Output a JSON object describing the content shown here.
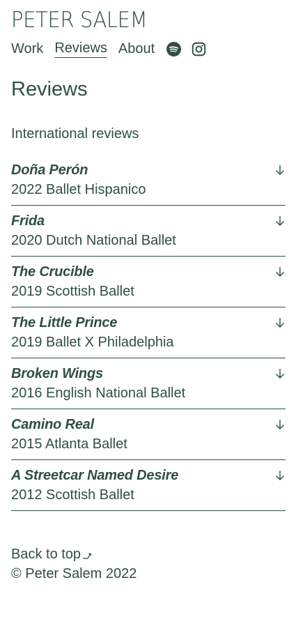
{
  "site": {
    "title": "PETER SALEM"
  },
  "nav": {
    "items": [
      {
        "label": "Work"
      },
      {
        "label": "Reviews"
      },
      {
        "label": "About"
      }
    ],
    "icons": [
      "spotify-icon",
      "instagram-icon"
    ]
  },
  "main": {
    "title": "Reviews",
    "section_label": "International reviews",
    "reviews": [
      {
        "title": "Doña Perón",
        "subtitle": "2022 Ballet Hispanico"
      },
      {
        "title": "Frida",
        "subtitle": "2020 Dutch National Ballet"
      },
      {
        "title": "The Crucible",
        "subtitle": "2019 Scottish Ballet"
      },
      {
        "title": "The Little Prince",
        "subtitle": "2019 Ballet X Philadelphia"
      },
      {
        "title": "Broken Wings",
        "subtitle": "2016 English National Ballet"
      },
      {
        "title": "Camino Real",
        "subtitle": "2015 Atlanta Ballet"
      },
      {
        "title": "A Streetcar Named Desire",
        "subtitle": "2012 Scottish Ballet"
      }
    ]
  },
  "footer": {
    "back_to_top": "Back to top",
    "copyright": "© Peter Salem 2022"
  },
  "colors": {
    "text": "#2f4f43",
    "background": "#ffffff"
  }
}
